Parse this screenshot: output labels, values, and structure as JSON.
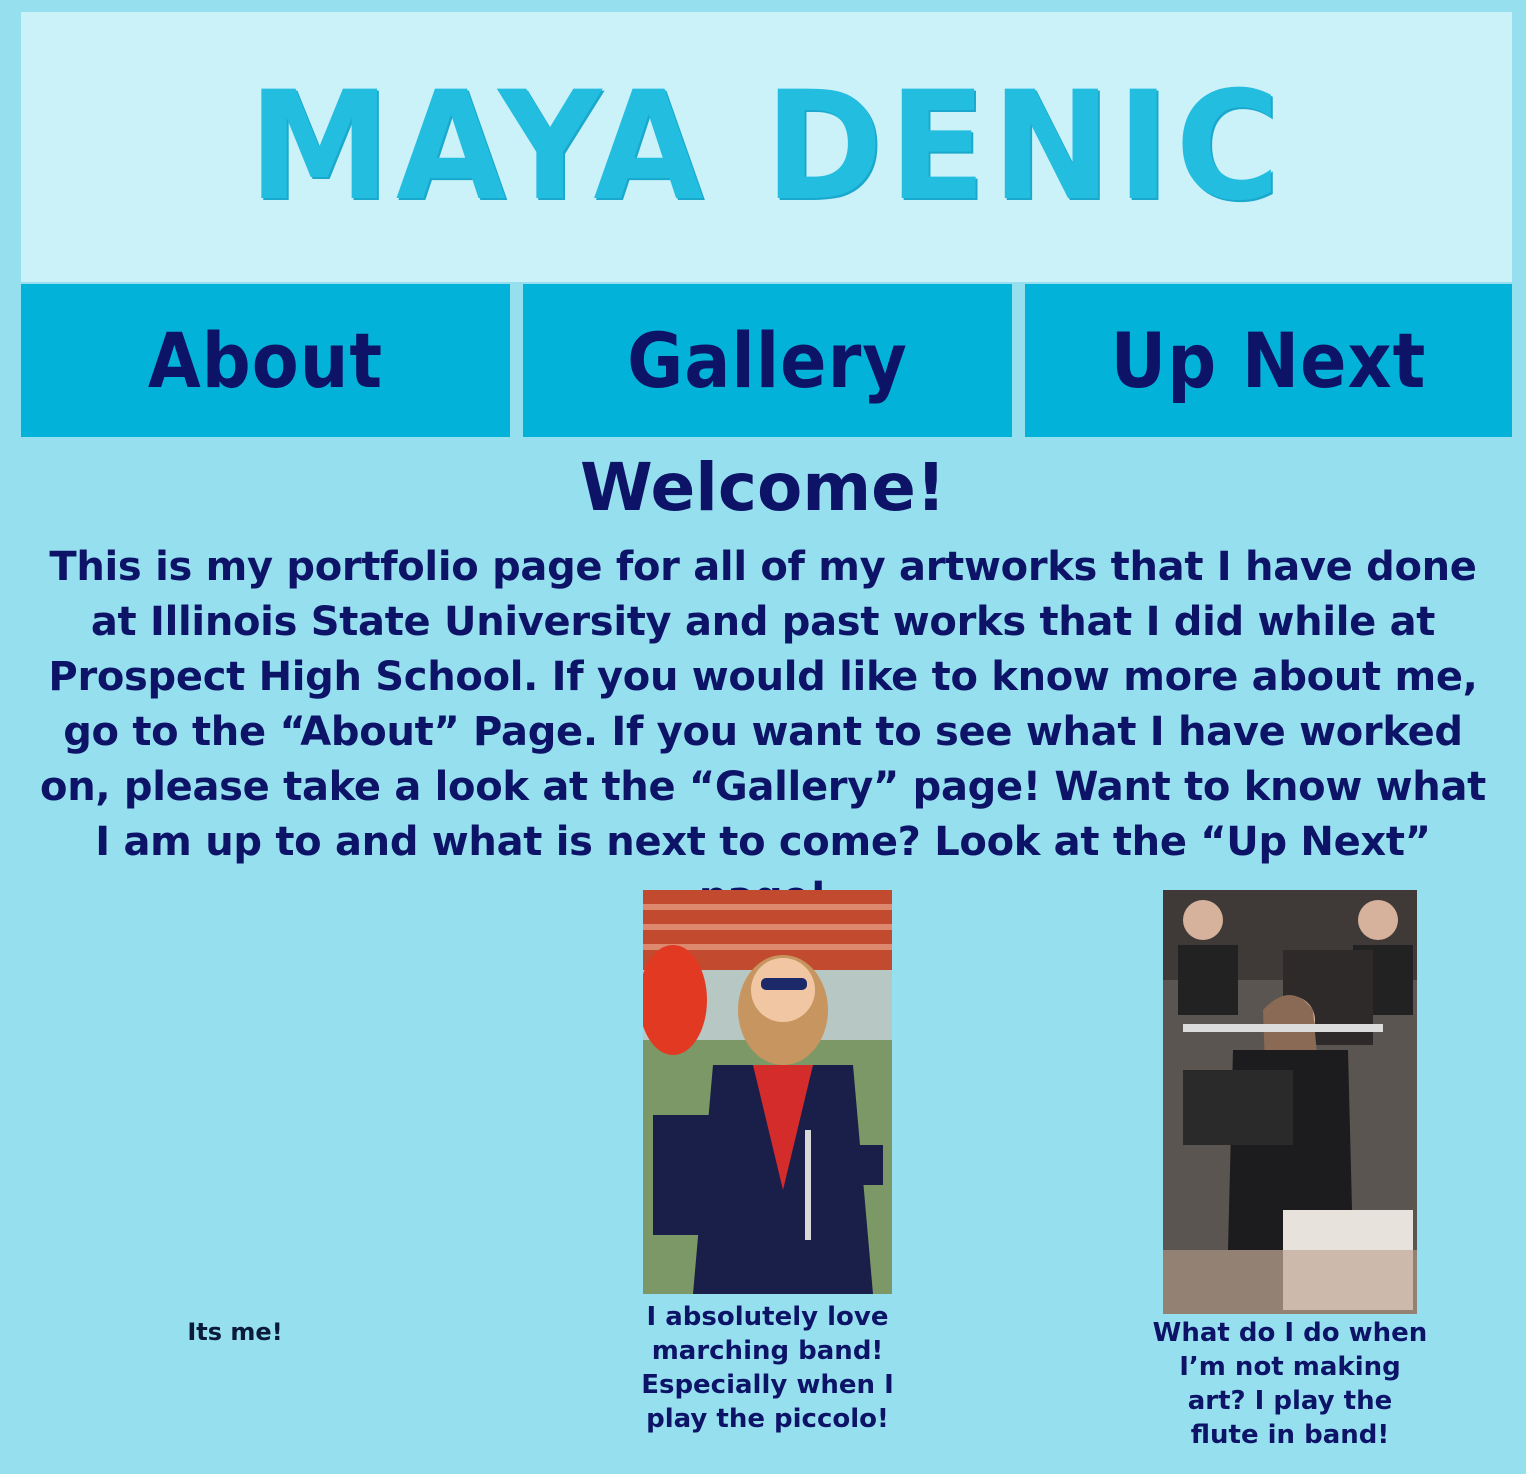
{
  "header": {
    "site_title": "MAYA DENIC"
  },
  "nav": {
    "items": [
      {
        "label": "About"
      },
      {
        "label": "Gallery"
      },
      {
        "label": "Up Next"
      }
    ]
  },
  "main": {
    "heading": "Welcome!",
    "intro": "This is my portfolio page for all of my artworks that I have done at Illinois State University and past works that I did while at Prospect High School. If you would like to know more about me, go to the “About” Page. If you want to see what I have worked on, please take a look at the “Gallery” page! Want to know what I am up to and what is next to come? Look at the “Up Next” page!"
  },
  "photos": [
    {
      "caption": "Its me!"
    },
    {
      "caption": "I absolutely love marching band! Especially when I play the piccolo!"
    },
    {
      "caption": "What do I do when I’m not making art? I play the flute in band!"
    }
  ],
  "colors": {
    "page_background": "#95dfef",
    "header_background": "#cbf1f9",
    "title_color": "#23bde0",
    "nav_background": "#03b2d8",
    "text_color": "#0d1467"
  }
}
